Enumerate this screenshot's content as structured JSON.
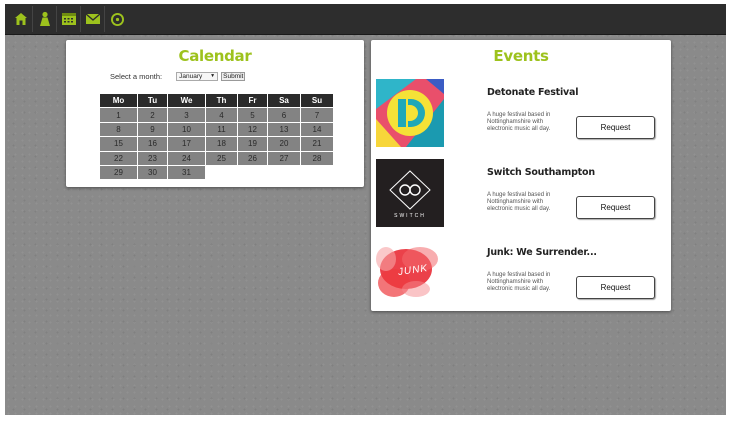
{
  "nav": {
    "items": [
      {
        "icon": "home-icon"
      },
      {
        "icon": "user-icon"
      },
      {
        "icon": "calendar-icon"
      },
      {
        "icon": "mail-icon"
      },
      {
        "icon": "record-icon"
      }
    ],
    "accent": "#9dc21d"
  },
  "calendar": {
    "title": "Calendar",
    "month_label": "Select a month:",
    "month_value": "January",
    "submit_label": "Submit",
    "weekdays": [
      "Mo",
      "Tu",
      "We",
      "Th",
      "Fr",
      "Sa",
      "Su"
    ],
    "days": [
      "1",
      "2",
      "3",
      "4",
      "5",
      "6",
      "7",
      "8",
      "9",
      "10",
      "11",
      "12",
      "13",
      "14",
      "15",
      "16",
      "17",
      "18",
      "19",
      "20",
      "21",
      "22",
      "23",
      "24",
      "25",
      "26",
      "27",
      "28",
      "29",
      "30",
      "31"
    ]
  },
  "events": {
    "title": "Events",
    "items": [
      {
        "name": "Detonate Festival",
        "description": "A huge festival based in Nottinghamshire with electronic music all day.",
        "button": "Request"
      },
      {
        "name": "Switch Southampton",
        "description": "A huge festival based in Nottinghamshire with electronic music all day.",
        "button": "Request",
        "logo_text": "SWITCH"
      },
      {
        "name": "Junk: We Surrender...",
        "description": "A huge festival based in Nottinghamshire with electronic music all day.",
        "button": "Request",
        "logo_text": "JUNK"
      }
    ]
  }
}
